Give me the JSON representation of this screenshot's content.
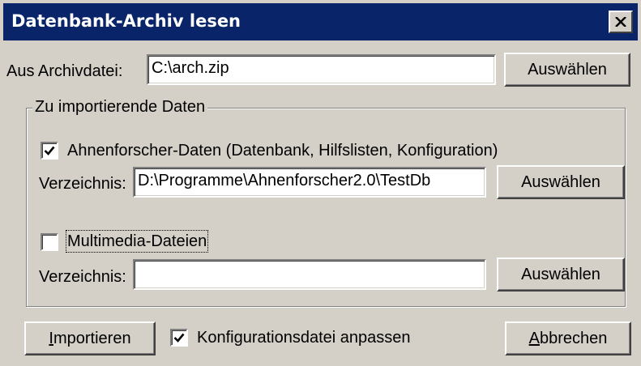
{
  "window": {
    "title": "Datenbank-Archiv lesen",
    "close_icon": "close-icon"
  },
  "archive": {
    "label": "Aus Archivdatei:",
    "value": "C:\\arch.zip",
    "select_button": "Auswählen"
  },
  "group": {
    "legend": "Zu importierende Daten",
    "ahnen": {
      "label": "Ahnenforscher-Daten (Datenbank, Hilfslisten, Konfiguration)",
      "checked": true,
      "dir_label": "Verzeichnis:",
      "dir_value": "D:\\Programme\\Ahnenforscher2.0\\TestDb",
      "select_button": "Auswählen"
    },
    "multimedia": {
      "label": "Multimedia-Dateien",
      "checked": false,
      "dir_label": "Verzeichnis:",
      "dir_value": "",
      "select_button": "Auswählen"
    }
  },
  "footer": {
    "import_accel": "I",
    "import_rest": "mportieren",
    "config_label": "Konfigurationsdatei anpassen",
    "config_checked": true,
    "cancel_accel": "A",
    "cancel_rest": "bbrechen"
  }
}
